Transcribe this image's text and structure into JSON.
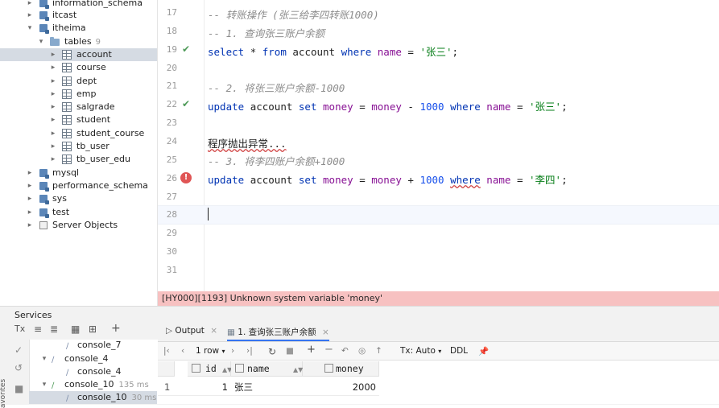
{
  "schema_tree": {
    "rows": [
      {
        "label": "information_schema",
        "type": "db",
        "expanded": false
      },
      {
        "label": "itcast",
        "type": "db",
        "expanded": false
      },
      {
        "label": "itheima",
        "type": "db",
        "expanded": true
      },
      {
        "label": "tables",
        "type": "folder",
        "expanded": true,
        "count": "9"
      },
      {
        "label": "account",
        "type": "table",
        "expanded": false,
        "selected": true
      },
      {
        "label": "course",
        "type": "table",
        "expanded": false
      },
      {
        "label": "dept",
        "type": "table",
        "expanded": false
      },
      {
        "label": "emp",
        "type": "table",
        "expanded": false
      },
      {
        "label": "salgrade",
        "type": "table",
        "expanded": false
      },
      {
        "label": "student",
        "type": "table",
        "expanded": false
      },
      {
        "label": "student_course",
        "type": "table",
        "expanded": false
      },
      {
        "label": "tb_user",
        "type": "table",
        "expanded": false
      },
      {
        "label": "tb_user_edu",
        "type": "table",
        "expanded": false
      },
      {
        "label": "mysql",
        "type": "db",
        "expanded": false
      },
      {
        "label": "performance_schema",
        "type": "db",
        "expanded": false
      },
      {
        "label": "sys",
        "type": "db",
        "expanded": false
      },
      {
        "label": "test",
        "type": "db",
        "expanded": false
      },
      {
        "label": "Server Objects",
        "type": "server",
        "expanded": false
      }
    ]
  },
  "editor": {
    "line_numbers": [
      "17",
      "18",
      "19",
      "20",
      "21",
      "22",
      "23",
      "24",
      "25",
      "26",
      "27",
      "28",
      "29",
      "30",
      "31"
    ],
    "lines": {
      "l17": "-- 转账操作 (张三给李四转账1000)",
      "l18": "-- 1. 查询张三账户余额",
      "l19": {
        "select": "select",
        "star": "*",
        "from": "from",
        "table": "account",
        "where": "where",
        "col": "name",
        "eq": "=",
        "val": "'张三'",
        "semi": ";"
      },
      "l21": "-- 2. 将张三账户余额-1000",
      "l22": {
        "update": "update",
        "table": "account",
        "set": "set",
        "col1": "money",
        "eq1": "=",
        "col2": "money",
        "op": "-",
        "num": "1000",
        "where": "where",
        "col3": "name",
        "eq2": "=",
        "val": "'张三'",
        "semi": ";"
      },
      "l24": "程序抛出异常...",
      "l25": "-- 3. 将李四账户余额+1000",
      "l26": {
        "update": "update",
        "table": "account",
        "set": "set",
        "col1": "money",
        "eq1": "=",
        "col2": "money",
        "op": "+",
        "num": "1000",
        "where": "where",
        "col3": "name",
        "eq2": "=",
        "val": "'李四'",
        "semi": ";"
      }
    },
    "error_message": "[HY000][1193] Unknown system variable 'money'"
  },
  "services": {
    "title": "Services",
    "toolbar": {
      "tx": "Tx",
      "add": "+"
    },
    "tree": [
      {
        "label": "console_7",
        "time": ""
      },
      {
        "label": "console_4",
        "time": ""
      },
      {
        "label": "console_4",
        "time": ""
      },
      {
        "label": "console_10",
        "time": "135 ms"
      },
      {
        "label": "console_10",
        "time": "30 ms"
      }
    ],
    "side_label": "avorites"
  },
  "results": {
    "tabs": [
      {
        "label": "Output"
      },
      {
        "label": "1. 查询张三账户余额"
      }
    ],
    "toolbar": {
      "rows": "1 row",
      "tx": "Tx: Auto",
      "ddl": "DDL"
    },
    "columns": [
      "id",
      "name",
      "money"
    ],
    "rows": [
      {
        "row_num": "1",
        "id": "1",
        "name": "张三",
        "money": "2000"
      }
    ]
  }
}
